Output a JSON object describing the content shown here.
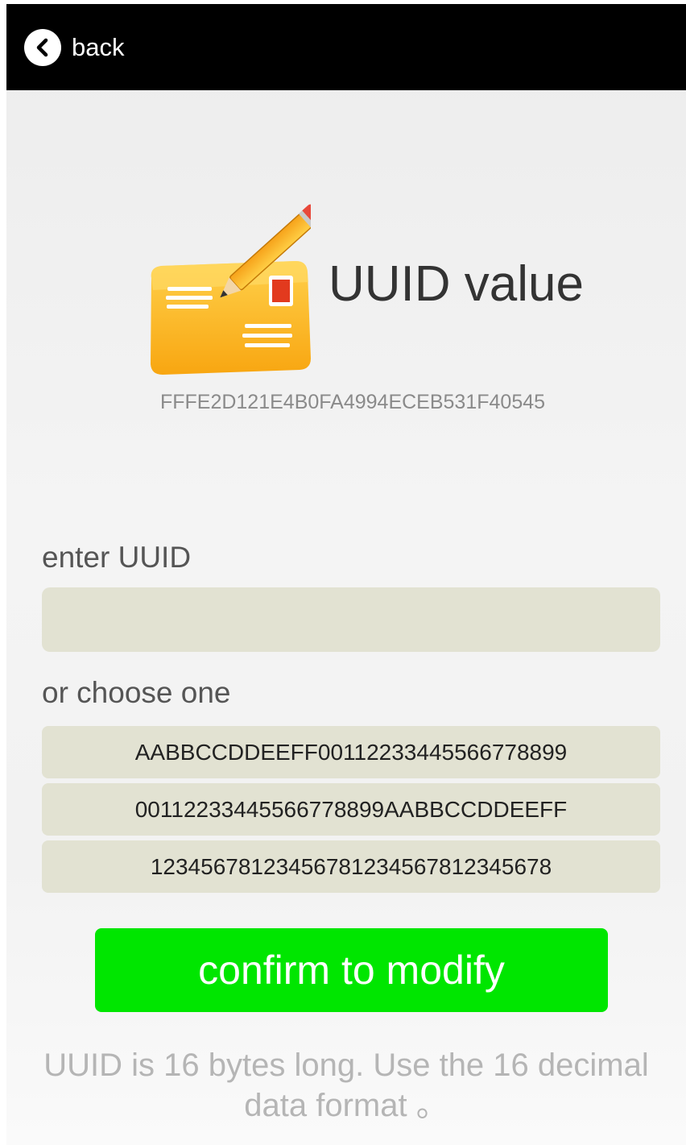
{
  "header": {
    "back_label": "back"
  },
  "main": {
    "title": "UUID value",
    "current_uuid": "FFFE2D121E4B0FA4994ECEB531F40545",
    "enter_label": "enter UUID",
    "input_value": "",
    "input_placeholder": "",
    "choose_label": "or choose one",
    "options": [
      "AABBCCDDEEFF00112233445566778899",
      "00112233445566778899AABBCCDDEEFF",
      "12345678123456781234567812345678"
    ],
    "confirm_label": "confirm to modify",
    "hint_line1": "UUID is 16 bytes long. Use the 16 decimal",
    "hint_line2": "data format 。"
  },
  "colors": {
    "topbar": "#000000",
    "confirm_button": "#00e600",
    "input_background": "#e2e2d2"
  },
  "icons": {
    "back": "chevron-left-icon",
    "hero": "envelope-pencil-icon"
  }
}
